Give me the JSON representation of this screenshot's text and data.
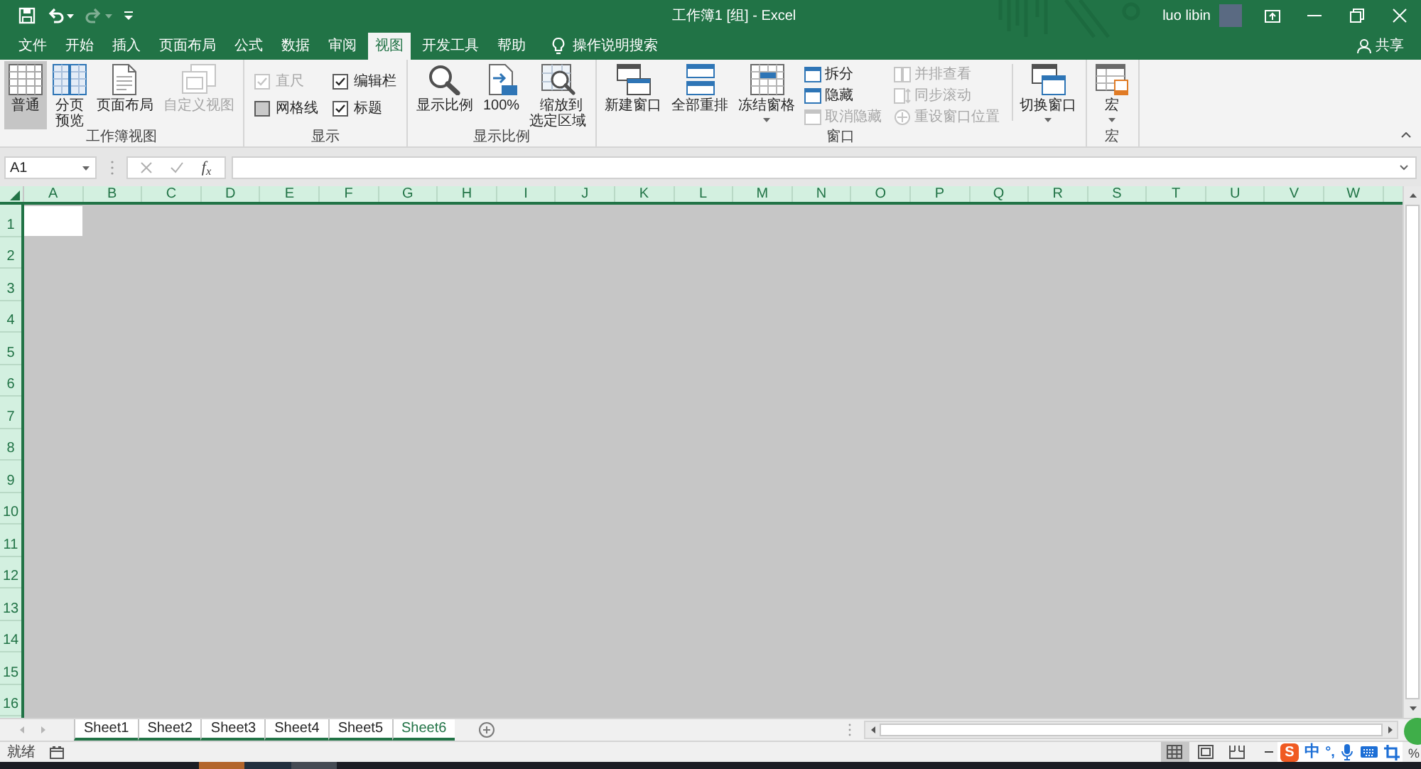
{
  "title_bar": {
    "quick_access": [
      {
        "kind": "save",
        "disabled": false
      },
      {
        "kind": "undo",
        "disabled": false
      },
      {
        "kind": "redo",
        "disabled": true
      },
      {
        "kind": "customize",
        "disabled": false
      }
    ],
    "title": "工作簿1 [组] - Excel",
    "user": "luo libin",
    "share": "共享"
  },
  "tabs": [
    {
      "label": "文件",
      "selected": false
    },
    {
      "label": "开始",
      "selected": false
    },
    {
      "label": "插入",
      "selected": false
    },
    {
      "label": "页面布局",
      "selected": false
    },
    {
      "label": "公式",
      "selected": false
    },
    {
      "label": "数据",
      "selected": false
    },
    {
      "label": "审阅",
      "selected": false
    },
    {
      "label": "视图",
      "selected": true
    },
    {
      "label": "开发工具",
      "selected": false
    },
    {
      "label": "帮助",
      "selected": false
    }
  ],
  "tell_me": {
    "label": "操作说明搜索"
  },
  "ribbon": {
    "groups": [
      {
        "label": "工作簿视图",
        "items": [
          {
            "kind": "large",
            "label": "普通",
            "selected": true,
            "disabled": false,
            "dropdown": false
          },
          {
            "kind": "large",
            "label": "分页预览",
            "selected": false,
            "disabled": false,
            "dropdown": false
          },
          {
            "kind": "large",
            "label": "页面布局",
            "selected": false,
            "disabled": false,
            "dropdown": false
          },
          {
            "kind": "large",
            "label": "自定义视图",
            "selected": false,
            "disabled": true,
            "dropdown": false
          }
        ]
      },
      {
        "label": "显示",
        "items": [
          {
            "kind": "checkbox",
            "label": "直尺",
            "checked": true,
            "disabled": true
          },
          {
            "kind": "checkbox",
            "label": "编辑栏",
            "checked": true,
            "disabled": false
          },
          {
            "kind": "checkbox",
            "label": "网格线",
            "checked": false,
            "disabled": false
          },
          {
            "kind": "checkbox",
            "label": "标题",
            "checked": true,
            "disabled": false
          }
        ]
      },
      {
        "label": "显示比例",
        "items": [
          {
            "kind": "large",
            "label": "显示比例",
            "disabled": false,
            "dropdown": false
          },
          {
            "kind": "large",
            "label": "100%",
            "disabled": false,
            "dropdown": false
          },
          {
            "kind": "large",
            "label": "缩放到选定区域",
            "disabled": false,
            "dropdown": false
          }
        ]
      },
      {
        "label": "窗口",
        "items": [
          {
            "kind": "large",
            "label": "新建窗口",
            "disabled": false,
            "dropdown": false
          },
          {
            "kind": "large",
            "label": "全部重排",
            "disabled": false,
            "dropdown": false
          },
          {
            "kind": "large",
            "label": "冻结窗格",
            "disabled": false,
            "dropdown": true
          },
          {
            "kind": "small",
            "label": "拆分",
            "disabled": false
          },
          {
            "kind": "small",
            "label": "隐藏",
            "disabled": false
          },
          {
            "kind": "small",
            "label": "取消隐藏",
            "disabled": true
          },
          {
            "kind": "small",
            "label": "并排查看",
            "disabled": true
          },
          {
            "kind": "small",
            "label": "同步滚动",
            "disabled": true
          },
          {
            "kind": "small",
            "label": "重设窗口位置",
            "disabled": true
          },
          {
            "kind": "large",
            "label": "切换窗口",
            "disabled": false,
            "dropdown": true
          }
        ]
      },
      {
        "label": "宏",
        "items": [
          {
            "kind": "large",
            "label": "宏",
            "disabled": false,
            "dropdown": true
          }
        ]
      }
    ]
  },
  "formula_bar": {
    "name_box": "A1",
    "insert_function": "f$_{x}$"
  },
  "grid": {
    "columns": [
      "A",
      "B",
      "C",
      "D",
      "E",
      "F",
      "G",
      "H",
      "I",
      "J",
      "K",
      "L",
      "M",
      "N",
      "O",
      "P",
      "Q",
      "R",
      "S",
      "T",
      "U",
      "V",
      "W"
    ],
    "rows": [
      "1",
      "2",
      "3",
      "4",
      "5",
      "6",
      "7",
      "8",
      "9",
      "10",
      "11",
      "12",
      "13",
      "14",
      "15",
      "16"
    ],
    "all_selected": true
  },
  "sheet_tabs": [
    {
      "label": "Sheet1",
      "selected": false
    },
    {
      "label": "Sheet2",
      "selected": false
    },
    {
      "label": "Sheet3",
      "selected": false
    },
    {
      "label": "Sheet4",
      "selected": false
    },
    {
      "label": "Sheet5",
      "selected": false
    },
    {
      "label": "Sheet6",
      "selected": true
    }
  ],
  "status_bar": {
    "status": "就绪",
    "views": [
      {
        "kind": "normal",
        "selected": true
      },
      {
        "kind": "page_layout",
        "selected": false
      },
      {
        "kind": "page_break",
        "selected": false
      }
    ],
    "zoom_reading": "%"
  },
  "ime_toolbar": {
    "logo": "S",
    "mode": "中",
    "punctuation": "°,"
  }
}
